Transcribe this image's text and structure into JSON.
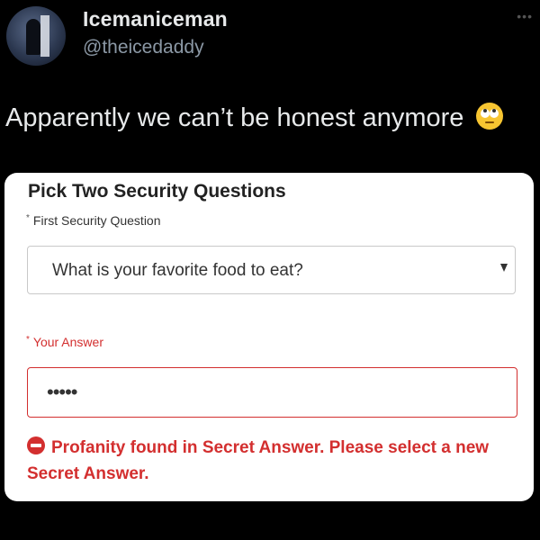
{
  "tweet": {
    "author_name": "Icemaniceman",
    "author_handle": "@theicedaddy",
    "text": "Apparently we can’t be honest anymore",
    "emoji": "face-with-rolling-eyes"
  },
  "form": {
    "title": "Pick Two Security Questions",
    "first_question_label": "First Security Question",
    "first_question_value": "What is your favorite food to eat?",
    "answer_label": "Your Answer",
    "answer_value": "•••••",
    "required_marker": "*",
    "error_message": "Profanity found in Secret Answer. Please select a new Secret Answer."
  },
  "colors": {
    "background": "#000000",
    "error": "#d32f2f",
    "card": "#ffffff"
  }
}
